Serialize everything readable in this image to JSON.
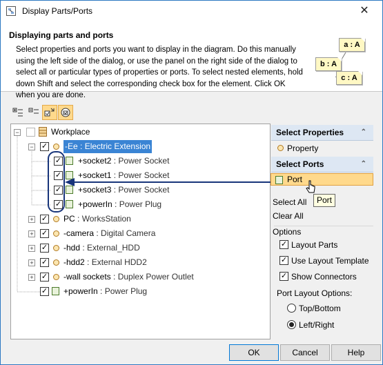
{
  "window": {
    "title": "Display Parts/Ports",
    "close_glyph": "✕"
  },
  "header": {
    "title": "Displaying parts and ports",
    "description": "Select properties and ports you want to display in the diagram. Do this manually using the left side of the dialog, or use the panel on the right side of the dialog to select all or particular types of properties or ports. To select nested elements, hold down Shift and select the corresponding check box for the element. Click OK when you are done.",
    "notes": [
      "a : A",
      "b : A",
      "c : A"
    ]
  },
  "toolbar": {
    "buttons": [
      {
        "name": "expand-all-icon",
        "active": false
      },
      {
        "name": "collapse-all-icon",
        "active": false
      },
      {
        "name": "select-recursively-icon",
        "active": true
      },
      {
        "name": "show-types-icon",
        "active": true
      }
    ]
  },
  "tree": {
    "root": {
      "name": "Workplace",
      "checked": false
    },
    "items": [
      {
        "name": "-Ee",
        "type": "Electric Extension",
        "kind": "part",
        "checked": true,
        "level": 1,
        "expander": "−",
        "selected": true
      },
      {
        "name": "+socket2",
        "type": "Power Socket",
        "kind": "port",
        "checked": true,
        "level": 2,
        "expander": "",
        "selected": false
      },
      {
        "name": "+socket1",
        "type": "Power Socket",
        "kind": "port",
        "checked": true,
        "level": 2,
        "expander": "",
        "selected": false
      },
      {
        "name": "+socket3",
        "type": "Power Socket",
        "kind": "port",
        "checked": true,
        "level": 2,
        "expander": "",
        "selected": false
      },
      {
        "name": "+powerIn",
        "type": "Power Plug",
        "kind": "port",
        "checked": true,
        "level": 2,
        "expander": "",
        "selected": false
      },
      {
        "name": "PC",
        "type": "WorksStation",
        "kind": "part",
        "checked": true,
        "level": 1,
        "expander": "+",
        "selected": false
      },
      {
        "name": "-camera",
        "type": "Digital Camera",
        "kind": "part",
        "checked": true,
        "level": 1,
        "expander": "+",
        "selected": false
      },
      {
        "name": "-hdd",
        "type": "External_HDD",
        "kind": "part",
        "checked": true,
        "level": 1,
        "expander": "+",
        "selected": false
      },
      {
        "name": "-hdd2",
        "type": "External HDD2",
        "kind": "part",
        "checked": true,
        "level": 1,
        "expander": "+",
        "selected": false
      },
      {
        "name": "-wall sockets",
        "type": "Duplex Power Outlet",
        "kind": "part",
        "checked": true,
        "level": 1,
        "expander": "+",
        "selected": false
      },
      {
        "name": "+powerIn",
        "type": "Power Plug",
        "kind": "port",
        "checked": true,
        "level": 1,
        "expander": "",
        "selected": false
      }
    ],
    "type_separator": " : "
  },
  "right_panel": {
    "select_properties_title": "Select Properties",
    "property_label": "Property",
    "select_ports_title": "Select Ports",
    "port_label": "Port",
    "select_all": "Select All",
    "clear_all": "Clear All",
    "options_title": "Options",
    "checkboxes": [
      {
        "label": "Layout Parts",
        "checked": true
      },
      {
        "label": "Use Layout Template",
        "checked": true
      },
      {
        "label": "Show Connectors",
        "checked": true
      }
    ],
    "port_layout_title": "Port Layout Options:",
    "radios": [
      {
        "label": "Top/Bottom",
        "checked": false
      },
      {
        "label": "Left/Right",
        "checked": true
      }
    ],
    "collapse_glyph": "⌃"
  },
  "tooltip": "Port",
  "buttons": {
    "ok": "OK",
    "cancel": "Cancel",
    "help": "Help"
  },
  "colors": {
    "selection": "#3a84d4",
    "accent": "#17347a",
    "highlight": "#ffd98c"
  }
}
